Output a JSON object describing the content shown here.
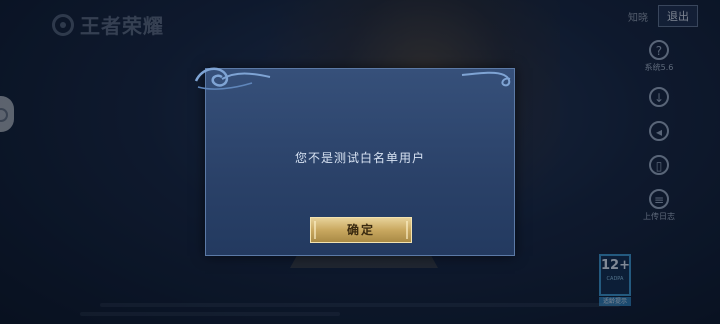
{
  "brand": {
    "logo_text": "王者荣耀"
  },
  "top_bar": {
    "hint_text": "知晓",
    "exit_label": "退出"
  },
  "side_tools": [
    {
      "icon": "help-icon",
      "glyph": "?",
      "label": "系统5.6"
    },
    {
      "icon": "download-icon",
      "glyph": "↓",
      "label": ""
    },
    {
      "icon": "volume-icon",
      "glyph": "◂",
      "label": ""
    },
    {
      "icon": "phone-icon",
      "glyph": "▯",
      "label": ""
    },
    {
      "icon": "log-icon",
      "glyph": "≡",
      "label": "上传日志"
    }
  ],
  "age_rating": {
    "value": "12+",
    "sub": "CADPA",
    "label": "适龄提示"
  },
  "dialog": {
    "message": "您不是测试白名单用户",
    "confirm_label": "确定"
  },
  "colors": {
    "dialog_bg": "#2a4168",
    "button_gold": "#c9a860",
    "accent_blue": "#3f9bd6"
  }
}
